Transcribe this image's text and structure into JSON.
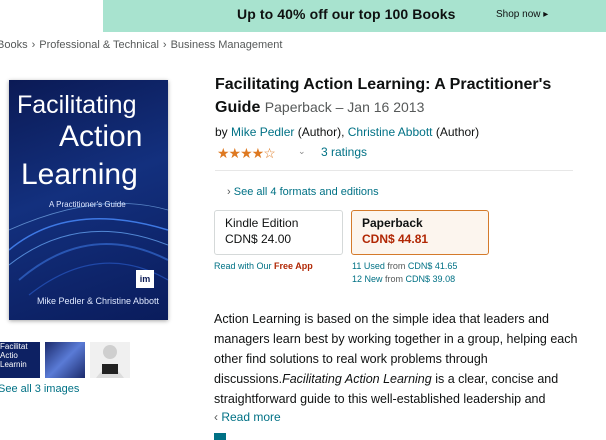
{
  "banner": {
    "text": "Up to 40% off our top 100 Books",
    "shop_now": "Shop now ▸"
  },
  "breadcrumb": [
    "Books",
    "Professional & Technical",
    "Business Management"
  ],
  "cover": {
    "title_line1": "Facilitating",
    "title_line2": "Action",
    "title_line3": "Learning",
    "subtitle": "A Practitioner's Guide",
    "authors": "Mike Pedler & Christine Abbott",
    "logo": "im"
  },
  "thumbnails": {
    "thumb1_text": "Facilitat Actio Learnin"
  },
  "see_all_images": "See all 3 images",
  "product": {
    "title": "Facilitating Action Learning: A Practitioner's Guide",
    "format_date": "Paperback – Jan 16 2013",
    "by": "by",
    "author1": "Mike Pedler",
    "author1_role": "(Author),",
    "author2": "Christine Abbott",
    "author2_role": "(Author)",
    "stars": "★★★★☆",
    "rating_value": 4.0,
    "ratings_count": "3 ratings"
  },
  "formats": {
    "see_all": "See all 4 formats and editions",
    "kindle": {
      "name": "Kindle Edition",
      "price": "CDN$ 24.00"
    },
    "paperback": {
      "name": "Paperback",
      "price": "CDN$ 44.81"
    },
    "read_app_prefix": "Read with Our",
    "read_app_free": "Free App",
    "used_link": "11 Used",
    "used_from": "from",
    "used_price": "CDN$ 41.65",
    "new_link": "12 New",
    "new_from": "from",
    "new_price": "CDN$ 39.08"
  },
  "description": {
    "part1": "Action Learning is based on the simple idea that leaders and managers learn best by working together in a group, helping each other find solutions to real work problems through discussions.",
    "italic": "Facilitating Action Learning",
    "part2": " is a clear, concise and straightforward guide to this well-established leadership and",
    "read_more": "Read more"
  },
  "colors": {
    "banner_bg": "#a8e3cf",
    "link": "#007185",
    "price_red": "#b12704",
    "star": "#de7921",
    "selected_border": "#d47a2b"
  }
}
